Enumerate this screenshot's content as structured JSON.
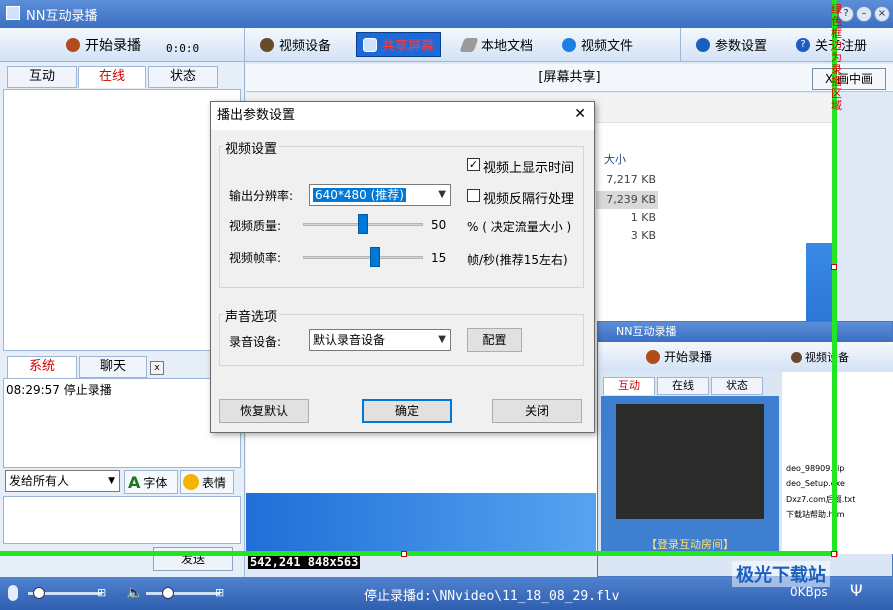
{
  "window": {
    "title": "NN互动录播",
    "vertical_notice": "绿色框边为录播区域"
  },
  "toolbar": {
    "record_label": "开始录播",
    "timer": "0:0:0",
    "items": [
      "视频设备",
      "共享屏幕",
      "本地文档",
      "视频文件",
      "参数设置",
      "关于注册"
    ]
  },
  "left_tabs": [
    "互动",
    "在线",
    "状态"
  ],
  "chat_tabs": [
    "系统",
    "聊天"
  ],
  "chat_close": "x",
  "log_line": "08:29:57  停止录播",
  "chat_controls": {
    "recipient": "发给所有人",
    "font": "字体",
    "emoji": "表情",
    "send": "发送"
  },
  "share_header": "[屏幕共享]",
  "pip_button": "X 画中画",
  "capture_info": "542,241 848x563",
  "explorer": {
    "size_header": "大小",
    "sizes": [
      "7,217 KB",
      "7,239 KB",
      "1 KB",
      "3 KB"
    ]
  },
  "dialog": {
    "title": "播出参数设置",
    "close": "✕",
    "video_group": "视频设置",
    "resolution_label": "输出分辨率:",
    "resolution_value": "640*480 (推荐)",
    "quality_label": "视频质量:",
    "quality_value": "50",
    "quality_fraction": 0.5,
    "quality_unit": "% ( 决定流量大小 )",
    "fps_label": "视频帧率:",
    "fps_value": "15",
    "fps_fraction": 0.6,
    "fps_unit": "帧/秒(推荐15左右)",
    "show_time_label": "视频上显示时间",
    "show_time_checked": true,
    "deinterlace_label": "视频反隔行处理",
    "deinterlace_checked": false,
    "audio_group": "声音选项",
    "audio_device_label": "录音设备:",
    "audio_device_value": "默认录音设备",
    "configure": "配置",
    "restore": "恢复默认",
    "ok": "确定",
    "close_btn": "关闭"
  },
  "mini_window": {
    "title": "NN互动录播",
    "record_label": "开始录播",
    "video_device": "视频设备",
    "tabs": [
      "互动",
      "在线",
      "状态"
    ],
    "login": "【登录互动房间】",
    "files": [
      "deo_98909.zip",
      "deo_Setup.exe",
      "Dxz7.com后缀.txt",
      "下载站帮助.htm"
    ]
  },
  "status": {
    "text": "停止录播d:\\NNvideo\\11_18_08_29.flv",
    "rate": "0KBps",
    "mic_level": 0.15,
    "speaker_level": 0.3
  },
  "watermark": "极光下载站"
}
